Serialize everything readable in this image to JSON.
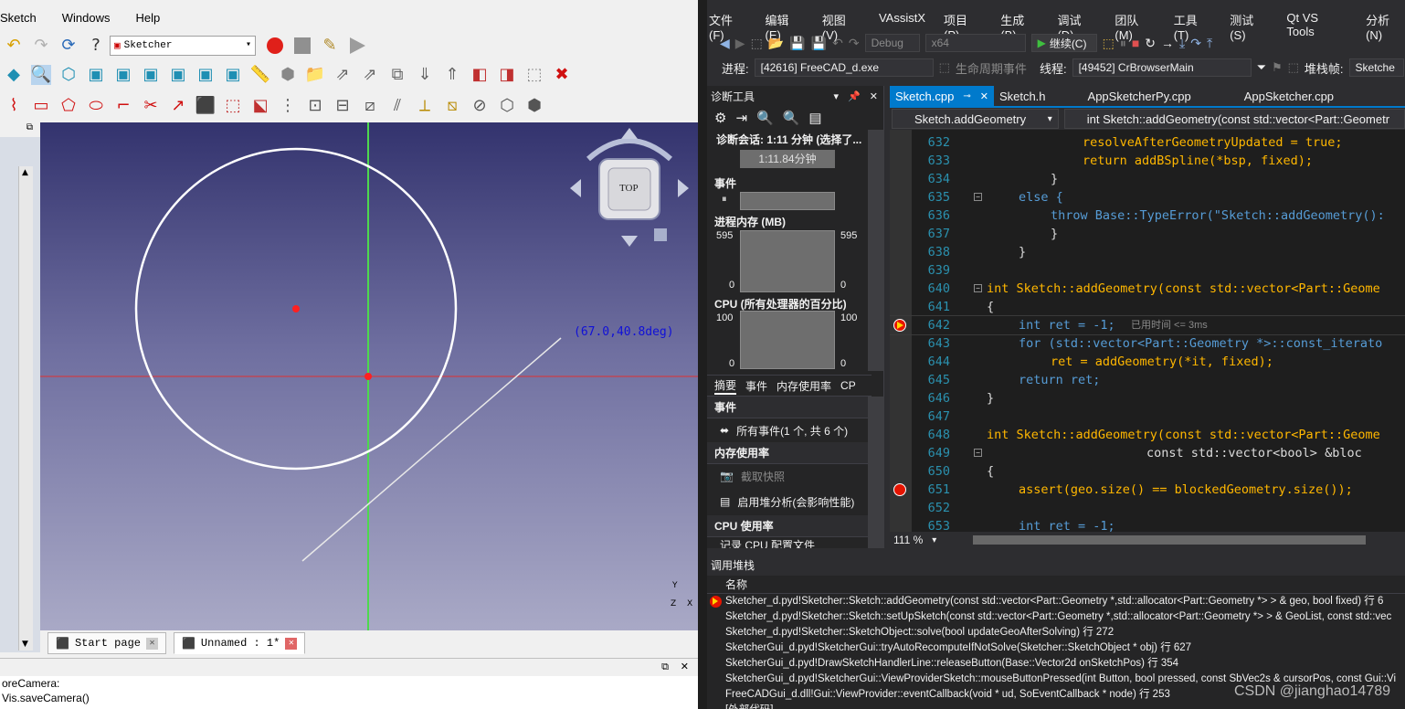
{
  "freecad": {
    "menu": [
      "Sketch",
      "Windows",
      "Help"
    ],
    "workbench": "Sketcher",
    "coord_readout": "(67.0,40.8deg)",
    "navcube_face": "TOP",
    "axis_y": "Y",
    "axis_z": "Z",
    "axis_x": "X",
    "tabs": [
      {
        "label": "Start page"
      },
      {
        "label": "Unnamed : 1*"
      }
    ],
    "report_lines": [
      "oreCamera:",
      "Vis.saveCamera()"
    ]
  },
  "vs": {
    "menu": [
      "文件(F)",
      "编辑(E)",
      "视图(V)",
      "VAssistX",
      "项目(P)",
      "生成(B)",
      "调试(D)",
      "团队(M)",
      "工具(T)",
      "测试(S)",
      "Qt VS Tools",
      "分析(N)"
    ],
    "toolbar1": {
      "config": "Debug",
      "platform": "x64",
      "continue": "继续(C)"
    },
    "toolbar2": {
      "process_label": "进程:",
      "process_value": "[42616] FreeCAD_d.exe",
      "lifecycle": "生命周期事件",
      "thread_label": "线程:",
      "thread_value": "[49452] CrBrowserMain",
      "stackframe_label": "堆栈帧:",
      "stackframe_value": "Sketche"
    },
    "diag": {
      "title": "诊断工具",
      "session": "诊断会话: 1:11 分钟 (选择了...",
      "timeline": "1:11.84分钟",
      "events_label": "事件",
      "memory_label": "进程内存 (MB)",
      "memory_max": "595",
      "memory_min": "0",
      "cpu_label": "CPU (所有处理器的百分比)",
      "cpu_max": "100",
      "cpu_min": "0",
      "tabs": [
        "摘要",
        "事件",
        "内存使用率",
        "CP"
      ],
      "sec_events": "事件",
      "all_events": "所有事件(1 个, 共 6 个)",
      "sec_memory": "内存使用率",
      "snapshot": "截取快照",
      "heap": "启用堆分析(会影响性能)",
      "sec_cpu": "CPU 使用率",
      "cpu_profile": "记录 CPU 配置文件"
    },
    "editor_tabs": [
      "Sketch.cpp",
      "Sketch.h",
      "AppSketcherPy.cpp",
      "AppSketcher.cpp"
    ],
    "nav_scope": "Sketch.addGeometry",
    "nav_member": "int Sketch::addGeometry(const std::vector<Part::Geometr",
    "zoom": "111 %",
    "elapsed": "已用时间 <= 3ms",
    "code_lines": [
      {
        "num": "632",
        "text": "resolveAfterGeometryUpdated = true;"
      },
      {
        "num": "633",
        "text": "return addBSpline(*bsp, fixed);"
      },
      {
        "num": "634",
        "text": "}"
      },
      {
        "num": "635",
        "text": "else {"
      },
      {
        "num": "636",
        "text": "throw Base::TypeError(\"Sketch::addGeometry():"
      },
      {
        "num": "637",
        "text": "}"
      },
      {
        "num": "638",
        "text": "}"
      },
      {
        "num": "639",
        "text": ""
      },
      {
        "num": "640",
        "text": "int Sketch::addGeometry(const std::vector<Part::Geome"
      },
      {
        "num": "641",
        "text": "{"
      },
      {
        "num": "642",
        "text": "int ret = -1;"
      },
      {
        "num": "643",
        "text": "for (std::vector<Part::Geometry *>::const_iterato"
      },
      {
        "num": "644",
        "text": "ret = addGeometry(*it, fixed);"
      },
      {
        "num": "645",
        "text": "return ret;"
      },
      {
        "num": "646",
        "text": "}"
      },
      {
        "num": "647",
        "text": ""
      },
      {
        "num": "648",
        "text": "int Sketch::addGeometry(const std::vector<Part::Geome"
      },
      {
        "num": "649",
        "text": "const std::vector<bool> &bloc"
      },
      {
        "num": "650",
        "text": "{"
      },
      {
        "num": "651",
        "text": "assert(geo.size() == blockedGeometry.size());"
      },
      {
        "num": "652",
        "text": ""
      },
      {
        "num": "653",
        "text": "int ret = -1;"
      }
    ],
    "callstack": {
      "title": "调用堆栈",
      "col_name": "名称",
      "rows": [
        "Sketcher_d.pyd!Sketcher::Sketch::addGeometry(const std::vector<Part::Geometry *,std::allocator<Part::Geometry *> > & geo, bool fixed) 行 6",
        "Sketcher_d.pyd!Sketcher::Sketch::setUpSketch(const std::vector<Part::Geometry *,std::allocator<Part::Geometry *> > & GeoList, const std::vec",
        "Sketcher_d.pyd!Sketcher::SketchObject::solve(bool updateGeoAfterSolving) 行 272",
        "SketcherGui_d.pyd!SketcherGui::tryAutoRecomputeIfNotSolve(Sketcher::SketchObject * obj) 行 627",
        "SketcherGui_d.pyd!DrawSketchHandlerLine::releaseButton(Base::Vector2d onSketchPos) 行 354",
        "SketcherGui_d.pyd!SketcherGui::ViewProviderSketch::mouseButtonPressed(int Button, bool pressed, const SbVec2s & cursorPos, const Gui::Vi",
        "FreeCADGui_d.dll!Gui::ViewProvider::eventCallback(void * ud, SoEventCallback * node) 行 253",
        "[外部代码]"
      ]
    },
    "watermark": "CSDN @jianghao14789"
  }
}
